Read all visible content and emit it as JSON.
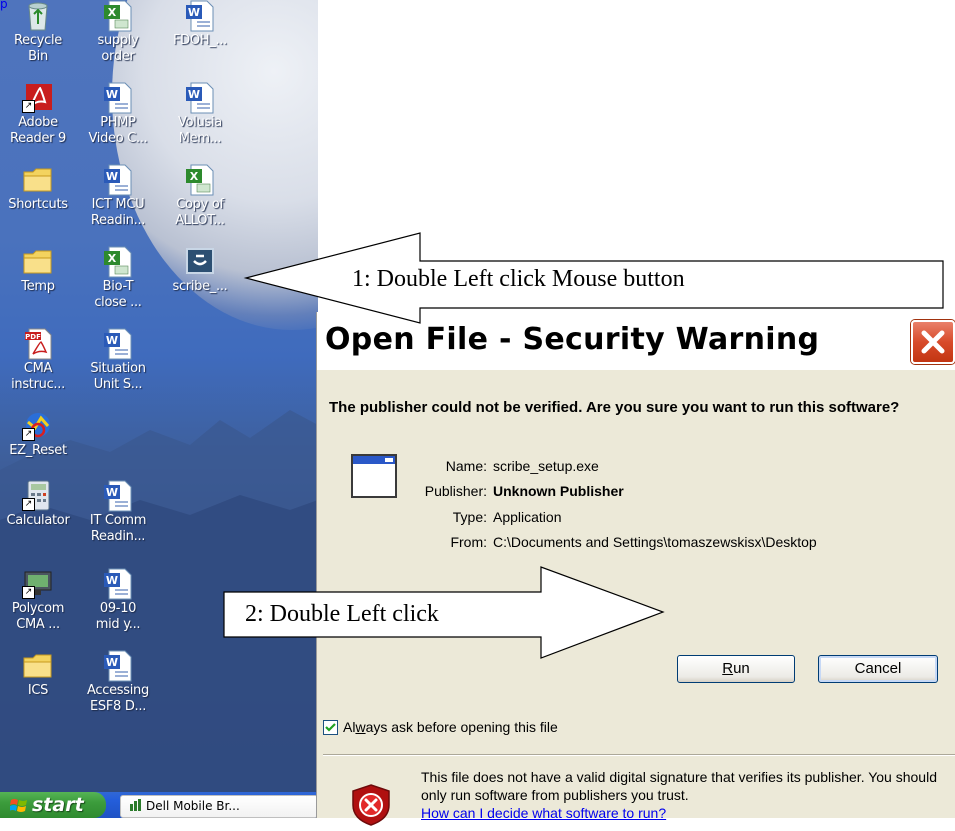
{
  "top_link_text": "p",
  "desktop_icons": [
    {
      "label": "Recycle\nBin",
      "icon": "recycle-bin-icon"
    },
    {
      "label": "supply\norder",
      "icon": "excel-file-icon"
    },
    {
      "label": "FDOH_...",
      "icon": "word-file-icon"
    },
    {
      "label": "Adobe\nReader 9",
      "icon": "adobe-reader-icon"
    },
    {
      "label": "PHMP\nVideo C...",
      "icon": "word-file-icon"
    },
    {
      "label": "Volusia\nMem...",
      "icon": "word-file-icon"
    },
    {
      "label": "Shortcuts",
      "icon": "folder-icon"
    },
    {
      "label": "ICT MCU\nReadin...",
      "icon": "word-file-icon"
    },
    {
      "label": "Copy of\nALLOT...",
      "icon": "excel-file-icon"
    },
    {
      "label": "Temp",
      "icon": "folder-icon"
    },
    {
      "label": "Bio-T\nclose ...",
      "icon": "excel-file-icon"
    },
    {
      "label": "scribe_...",
      "icon": "scribe-setup-icon"
    },
    {
      "label": "CMA\ninstruc...",
      "icon": "pdf-file-icon"
    },
    {
      "label": "Situation\nUnit S...",
      "icon": "word-file-icon"
    },
    {
      "label": "EZ_Reset",
      "icon": "ez-reset-icon"
    },
    {
      "label": "Calculator",
      "icon": "calculator-icon"
    },
    {
      "label": "IT Comm\nReadin...",
      "icon": "word-file-icon"
    },
    {
      "label": "Polycom\nCMA ...",
      "icon": "polycom-icon"
    },
    {
      "label": "09-10\nmid y...",
      "icon": "word-file-icon"
    },
    {
      "label": "ICS",
      "icon": "folder-icon"
    },
    {
      "label": "Accessing\nESF8 D...",
      "icon": "word-file-icon"
    }
  ],
  "taskbar": {
    "start_label": "start",
    "start_icon": "windows-flag-icon",
    "task_label": "Dell Mobile Br...",
    "task_icon": "dell-mobile-icon"
  },
  "callouts": {
    "step1": "1: Double Left click Mouse button",
    "step2": "2: Double Left click"
  },
  "dialog": {
    "title": "Open File - Security Warning",
    "question": "The publisher could not be verified.  Are you sure you want to run this software?",
    "details": [
      {
        "key": "Name:",
        "value": "scribe_setup.exe",
        "bold": false
      },
      {
        "key": "Publisher:",
        "value": "Unknown Publisher",
        "bold": true
      },
      {
        "key": "Type:",
        "value": "Application",
        "bold": false
      },
      {
        "key": "From:",
        "value": "C:\\Documents and Settings\\tomaszewskisx\\Desktop",
        "bold": false
      }
    ],
    "run_label": "Run",
    "cancel_label": "Cancel",
    "checkbox_label": "Always ask before opening this file",
    "checkbox_checked": true,
    "warning_text": "This file does not have a valid digital signature that verifies its publisher.  You should only run software from publishers you trust.",
    "help_link": "How can I decide what software to run?",
    "colors": {
      "title_bg": "#ffffff",
      "body_bg": "#ece9d8",
      "close_red": "#d84b2a",
      "link": "#0000ee"
    }
  }
}
